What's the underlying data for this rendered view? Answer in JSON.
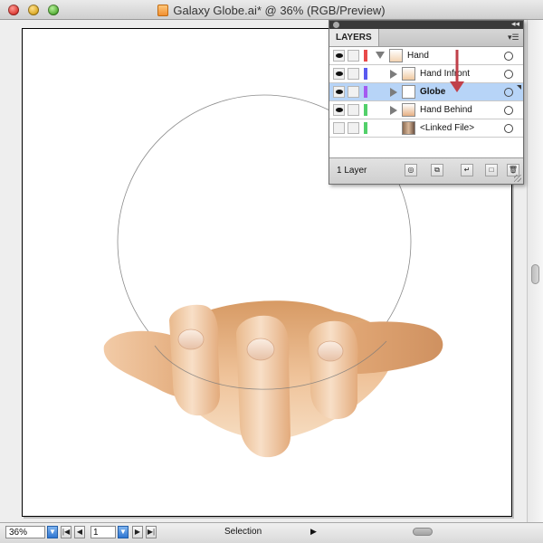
{
  "window": {
    "title": "Galaxy Globe.ai* @ 36% (RGB/Preview)"
  },
  "layers_panel": {
    "tab_label": "LAYERS",
    "collapse_glyph": "◂◂",
    "menu_glyph": "▾☰",
    "layers": [
      {
        "name": "Hand",
        "level": 0,
        "expanded": true,
        "visible": true,
        "color": "#e84a4a",
        "selected": false
      },
      {
        "name": "Hand Infront",
        "level": 1,
        "expanded": false,
        "visible": true,
        "color": "#5a5af0",
        "selected": false
      },
      {
        "name": "Globe",
        "level": 1,
        "expanded": false,
        "visible": true,
        "color": "#a45af0",
        "selected": true
      },
      {
        "name": "Hand Behind",
        "level": 1,
        "expanded": false,
        "visible": true,
        "color": "#52d06a",
        "selected": false
      },
      {
        "name": "<Linked File>",
        "level": 1,
        "expanded": false,
        "visible": false,
        "color": "#52d06a",
        "selected": false
      }
    ],
    "footer_count": "1 Layer",
    "footer_buttons": [
      "locate-object",
      "make-clipping-mask",
      "create-new-sublayer",
      "create-new-layer",
      "delete-selection"
    ]
  },
  "statusbar": {
    "zoom": "36%",
    "page": "1",
    "status_label": "Selection",
    "nav_glyphs": {
      "first": "|◀",
      "prev": "◀",
      "next": "▶",
      "last": "▶|",
      "status_menu": "▶",
      "dropdown": "▼"
    }
  },
  "colors": {
    "selection_highlight": "#b7d4f7",
    "arrow_annotation": "#c0404a",
    "skin_light": "#f4d3b2",
    "skin_dark": "#d9a06d"
  }
}
